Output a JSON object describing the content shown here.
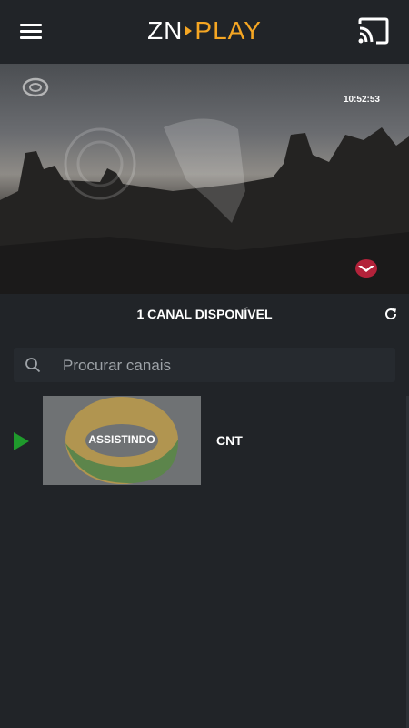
{
  "app": {
    "logo_left": "ZN",
    "logo_right": "PLAY",
    "accent_color": "#f5a623"
  },
  "player": {
    "clock": "10:52:53"
  },
  "channels": {
    "count_text": "1 CANAL DISPONÍVEL"
  },
  "search": {
    "placeholder": "Procurar canais",
    "value": ""
  },
  "list": [
    {
      "name": "CNT",
      "status": "ASSISTINDO"
    }
  ],
  "icons": {
    "menu": "menu-icon",
    "cast": "cast-icon",
    "refresh": "refresh-icon",
    "search": "search-icon",
    "playing": "play-icon"
  }
}
